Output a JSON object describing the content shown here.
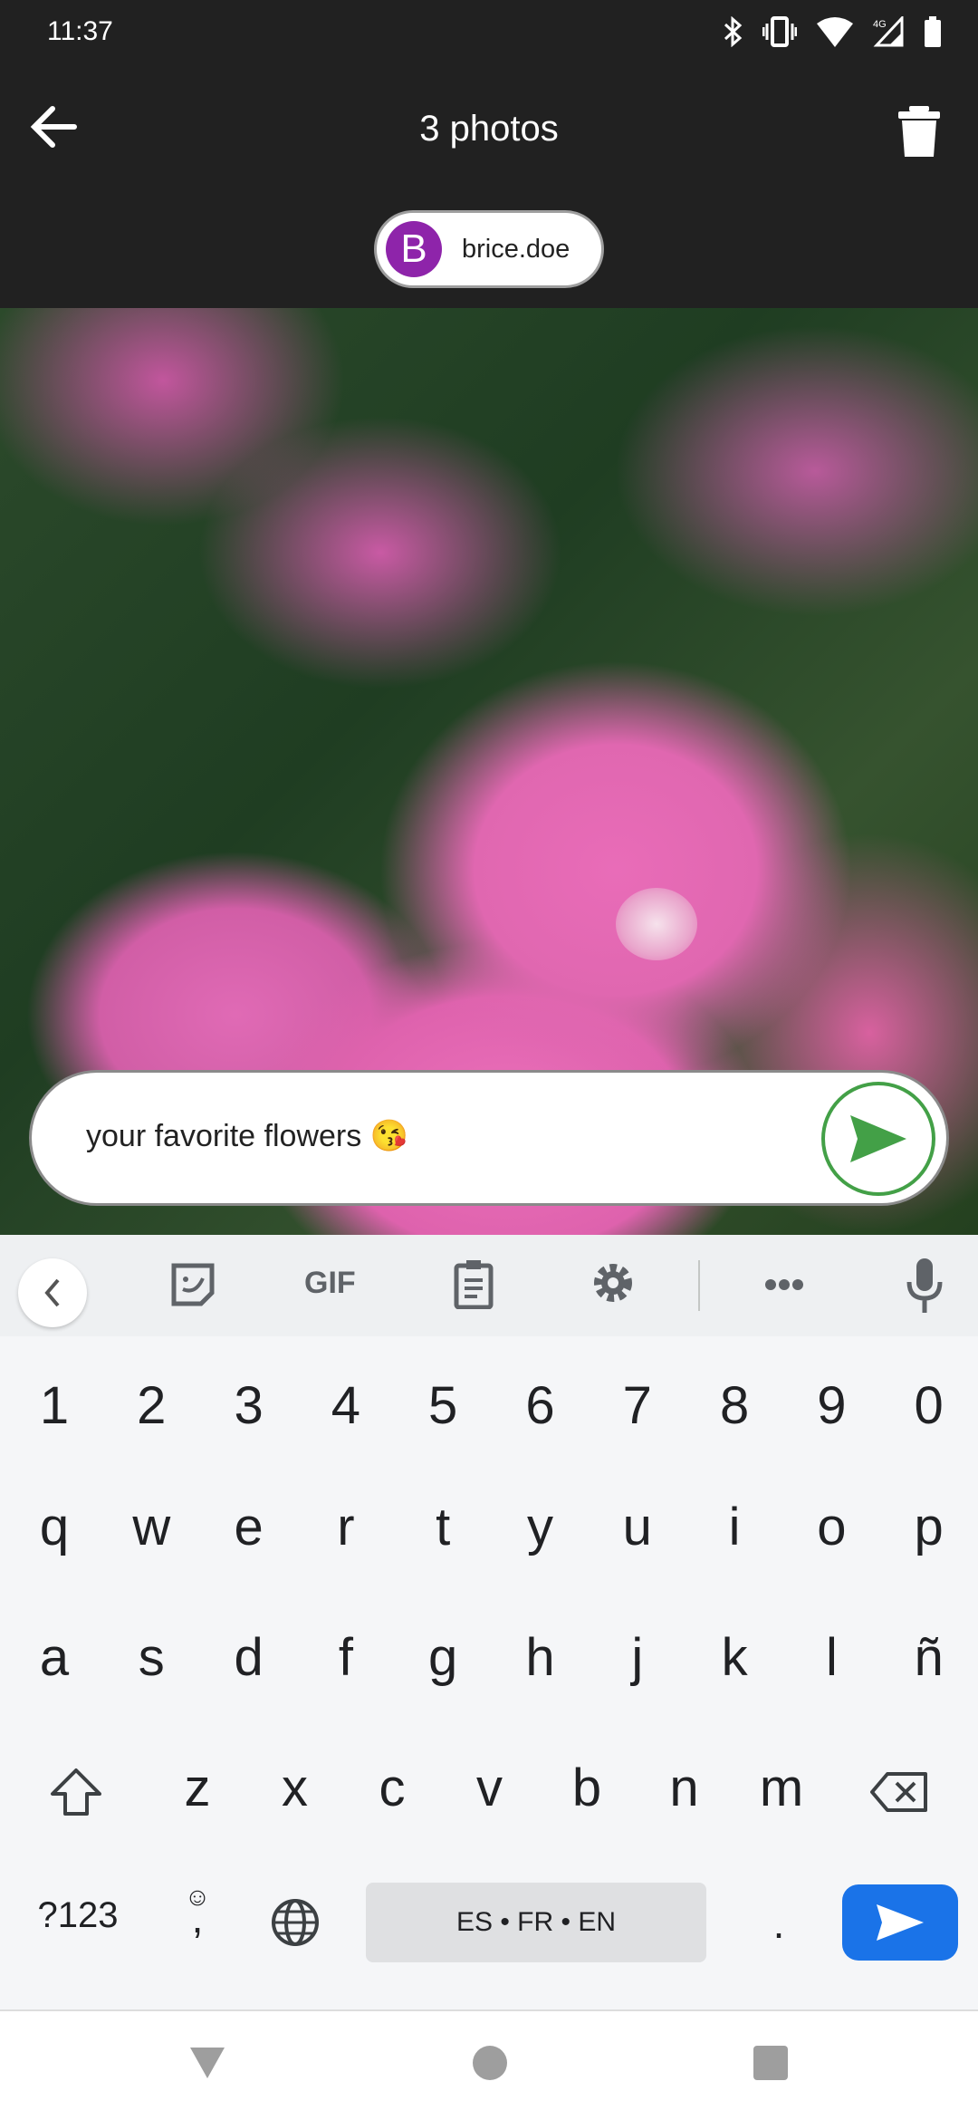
{
  "status_bar": {
    "time": "11:37",
    "icons": [
      "bluetooth-icon",
      "vibrate-icon",
      "wifi-icon",
      "signal-4g-icon",
      "battery-icon"
    ],
    "network": "4G"
  },
  "app_bar": {
    "title": "3 photos",
    "back_icon": "arrow-left-icon",
    "delete_icon": "trash-icon"
  },
  "recipient": {
    "initial": "B",
    "name": "brice.doe",
    "avatar_color": "#8e24aa"
  },
  "message": {
    "text": "your favorite flowers 😘",
    "send_color": "#43a047"
  },
  "keyboard": {
    "toolbar": {
      "gif": "GIF",
      "icons": [
        "chevron-left-icon",
        "sticker-icon",
        "gif-icon",
        "clipboard-icon",
        "gear-icon",
        "more-icon",
        "mic-icon"
      ]
    },
    "numbers": [
      "1",
      "2",
      "3",
      "4",
      "5",
      "6",
      "7",
      "8",
      "9",
      "0"
    ],
    "row1": [
      "q",
      "w",
      "e",
      "r",
      "t",
      "y",
      "u",
      "i",
      "o",
      "p"
    ],
    "row2": [
      "a",
      "s",
      "d",
      "f",
      "g",
      "h",
      "j",
      "k",
      "l",
      "ñ"
    ],
    "row3": [
      "z",
      "x",
      "c",
      "v",
      "b",
      "n",
      "m"
    ],
    "symbols": "?123",
    "comma": ",",
    "emoji": "☺",
    "space": "ES • FR • EN",
    "period": ".",
    "enter_color": "#1a73e8"
  }
}
